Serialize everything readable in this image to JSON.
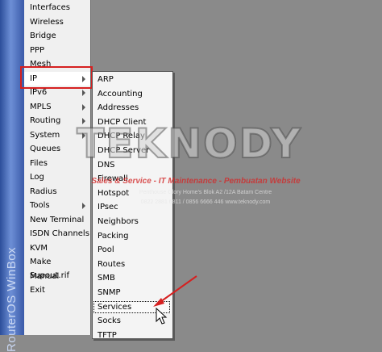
{
  "window": {
    "side_title": "RouterOS WinBox"
  },
  "main_menu": {
    "items": [
      {
        "label": "Interfaces",
        "submenu": false
      },
      {
        "label": "Wireless",
        "submenu": false
      },
      {
        "label": "Bridge",
        "submenu": false
      },
      {
        "label": "PPP",
        "submenu": false
      },
      {
        "label": "Mesh",
        "submenu": false
      },
      {
        "label": "IP",
        "submenu": true
      },
      {
        "label": "IPv6",
        "submenu": true
      },
      {
        "label": "MPLS",
        "submenu": true
      },
      {
        "label": "Routing",
        "submenu": true
      },
      {
        "label": "System",
        "submenu": true
      },
      {
        "label": "Queues",
        "submenu": false
      },
      {
        "label": "Files",
        "submenu": false
      },
      {
        "label": "Log",
        "submenu": false
      },
      {
        "label": "Radius",
        "submenu": false
      },
      {
        "label": "Tools",
        "submenu": true
      },
      {
        "label": "New Terminal",
        "submenu": false
      },
      {
        "label": "ISDN Channels",
        "submenu": false
      },
      {
        "label": "KVM",
        "submenu": false
      },
      {
        "label": "Make Supout.rif",
        "submenu": false
      },
      {
        "label": "Manual",
        "submenu": false
      },
      {
        "label": "Exit",
        "submenu": false
      }
    ],
    "active_item": "IP"
  },
  "ip_submenu": {
    "items": [
      "ARP",
      "Accounting",
      "Addresses",
      "DHCP Client",
      "DHCP Relay",
      "DHCP Server",
      "DNS",
      "Firewall",
      "Hotspot",
      "IPsec",
      "Neighbors",
      "Packing",
      "Pool",
      "Routes",
      "SMB",
      "SNMP",
      "Services",
      "Socks",
      "TFTP"
    ],
    "active_item": "Services"
  },
  "watermark": {
    "brand": "TEKNODY",
    "line1": "Sales & Service - IT Maintenance - Pembuatan Website",
    "line2": "Penthouse Glory Home's Blok A2 /12A Batam Centre",
    "line3": "0822 2881 6811 / 0856 6666 446  www.teknody.com"
  },
  "colors": {
    "highlight_box": "#d62020",
    "strip": "#4a6cc0"
  }
}
